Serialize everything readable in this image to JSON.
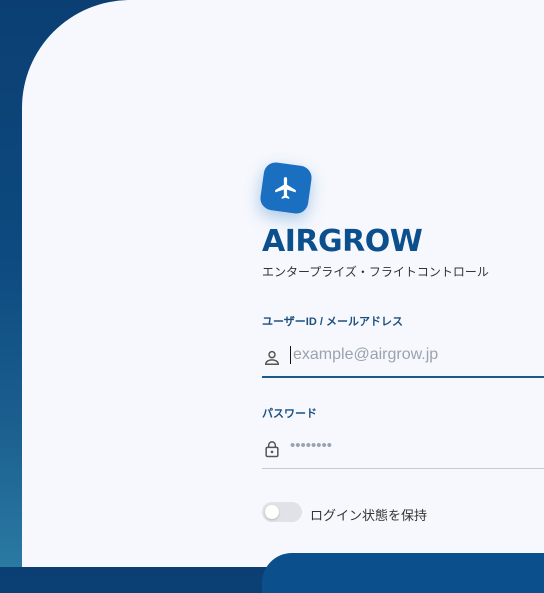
{
  "brand": {
    "title": "AIRGROW",
    "subtitle": "エンタープライズ・フライトコントロール",
    "logo_icon": "airplane-icon",
    "accent_color": "#1a6fc0"
  },
  "form": {
    "user": {
      "label": "ユーザーID / メールアドレス",
      "placeholder": "example@airgrow.jp",
      "icon": "person-icon"
    },
    "password": {
      "label": "パスワード",
      "value_masked": "••••••••",
      "icon": "lock-icon"
    },
    "remember": {
      "label": "ログイン状態を保持",
      "checked": false
    },
    "submit_color": "#0b4f8c"
  }
}
